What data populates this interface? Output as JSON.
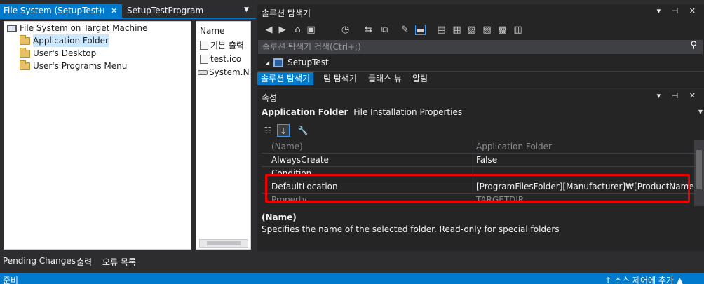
{
  "left_tabs": {
    "active": "File System (SetupTest)",
    "inactive": "SetupTestProgram",
    "pin": "⊣",
    "close": "✕",
    "dropdown": "▼"
  },
  "tree": {
    "root": "File System on Target Machine",
    "items": [
      "Application Folder",
      "User's Desktop",
      "User's Programs Menu"
    ]
  },
  "list": {
    "header": "Name",
    "items": [
      "기본 출력",
      "test.ico",
      "System.Ne"
    ]
  },
  "solution": {
    "title": "솔루션 탐색기",
    "controls": "▾ ⊣ ✕",
    "search_placeholder": "솔루션 탐색기 검색(Ctrl+;)",
    "project": "SetupTest",
    "tabs": [
      "솔루션 탐색기",
      "팀 탐색기",
      "클래스 뷰",
      "알림"
    ]
  },
  "properties": {
    "title": "속성",
    "controls": "▾ ⊣ ✕",
    "object_name": "Application Folder",
    "object_type": "File Installation Properties",
    "rows": [
      {
        "name": "(Name)",
        "value": "Application Folder"
      },
      {
        "name": "AlwaysCreate",
        "value": "False"
      },
      {
        "name": "Condition",
        "value": ""
      },
      {
        "name": "DefaultLocation",
        "value": "[ProgramFilesFolder][Manufacturer]₩[ProductName]"
      },
      {
        "name": "Property",
        "value": "TARGETDIR"
      }
    ],
    "desc_name": "(Name)",
    "desc_text": "Specifies the name of the selected folder. Read-only for special folders"
  },
  "bottom_tabs": [
    "Pending Changes",
    "출력",
    "오류 목록"
  ],
  "status": {
    "left": "준비",
    "right": "↑ 소스 제어에 추가 ▲"
  }
}
